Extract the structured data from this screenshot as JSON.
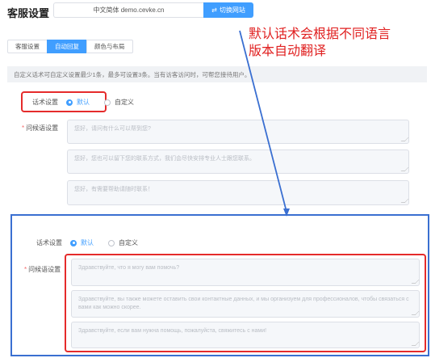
{
  "header": {
    "title": "客服设置",
    "site_select": "中文简体 demo.cevke.cn",
    "switch_button": "切换网站"
  },
  "tabs": [
    {
      "label": "客服设置",
      "active": false
    },
    {
      "label": "自动回复",
      "active": true
    },
    {
      "label": "颜色与布局",
      "active": false
    }
  ],
  "info_text": "自定义话术可自定义设置最少1条，最多可设置3条。当有访客访问时，可帮您接待用户。",
  "top_section": {
    "script_label": "话术设置",
    "option_default": "默认",
    "option_custom": "自定义",
    "greeting_label": "问候语设置",
    "greetings": [
      "您好，请问有什么可以帮到您?",
      "您好，您也可以留下您的联系方式，我们会尽快安排专业人士跟您联系。",
      "您好，有需要帮助请随时联系！"
    ]
  },
  "annotation": {
    "line1": "默认话术会根据不同语言",
    "line2": "版本自动翻译"
  },
  "bottom_section": {
    "script_label": "话术设置",
    "option_default": "默认",
    "option_custom": "自定义",
    "greeting_label": "问候语设置",
    "greetings": [
      "Здравствуйте, что я могу вам помочь?",
      "Здравствуйте, вы также можете оставить свои контактные данных, и мы организуем для профессионалов, чтобы связаться с вами как можно скорее.",
      "Здравствуйте, если вам нужна помощь, пожалуйста, свяжитесь с нами!"
    ]
  },
  "colors": {
    "accent": "#409eff",
    "highlight_red": "#e52b2b",
    "frame_blue": "#3a6fd1",
    "annotation_red": "#e02020"
  }
}
